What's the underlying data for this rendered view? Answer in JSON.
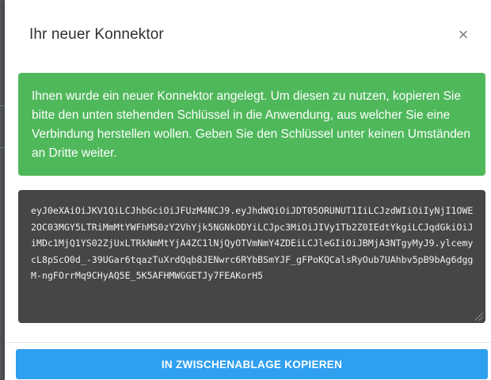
{
  "dialog": {
    "title": "Ihr neuer Konnektor",
    "close_symbol": "×",
    "close_icon": "close-icon"
  },
  "alert": {
    "message": "Ihnen wurde ein neuer Konnektor angelegt. Um diesen zu nutzen, kopieren Sie bitte den unten stehenden Schlüssel in die Anwendung, aus welcher Sie eine Verbindung herstellen wollen. Geben Sie den Schlüssel unter keinen Umständen an Dritte weiter.",
    "color": "#4fb85b"
  },
  "token": {
    "value": "eyJ0eXAiOiJKV1QiLCJhbGciOiJFUzM4NCJ9.eyJhdWQiOiJDT05ORUNUT1IiLCJzdWIiOiIyNjI1OWE2OC03MGY5LTRiMmMtYWFhMS0zY2VhYjk5NGNkODYiLCJpc3MiOiJIVy1Tb2Z0IEdtYkgiLCJqdGkiOiJiMDc1MjQ1YS02ZjUxLTRkNmMtYjA4ZC1lNjQyOTVmNmY4ZDEiLCJleGIiOiJBMjA3NTgyMyJ9.ylcemycL8pScO0d_-39UGar6tqazTuXrdQqb8JENwrc6RYbBSmYJF_gFPoKQCalsRyOub7UAhbv5pB9bAg6dggM-ngFOrrMq9CHyAQ5E_5K5AFHMWGGETJy7FEAKorH5"
  },
  "footer": {
    "copy_label": "IN ZWISCHENABLAGE KOPIEREN",
    "button_color": "#2f9ff0"
  }
}
